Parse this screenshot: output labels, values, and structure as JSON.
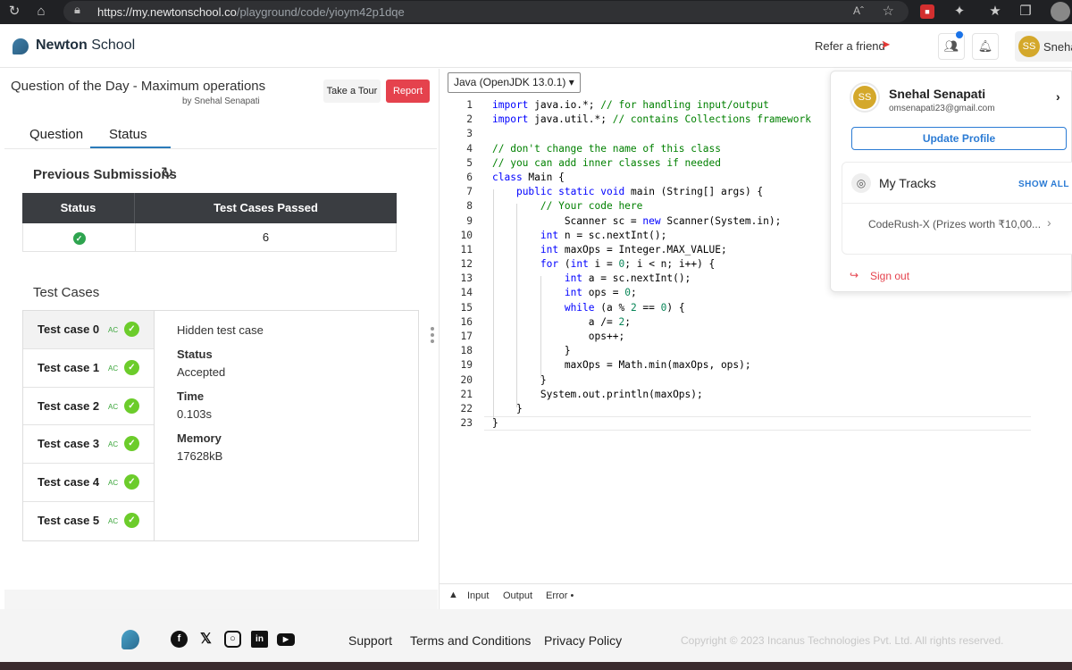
{
  "browser": {
    "url_host": "https://my.newtonschool.co",
    "url_path": "/playground/code/yioym42p1dqe",
    "read_aloud": "Á"
  },
  "topnav": {
    "logo_bold": "Newton",
    "logo_rest": " School",
    "refer": "Refer a friend",
    "user_initials": "SS",
    "user_name": "Sneha"
  },
  "question": {
    "title": "Question of the Day - Maximum operations",
    "by": "by Snehal Senapati",
    "tour_label": "Take a Tour",
    "report_label": "Report"
  },
  "tabs": [
    "Question",
    "Status"
  ],
  "submissions": {
    "title": "Previous Submissions",
    "columns": [
      "Status",
      "Test Cases Passed"
    ],
    "rows": [
      {
        "status": "passed",
        "passed": "6"
      }
    ]
  },
  "test_cases": {
    "title": "Test Cases",
    "items": [
      {
        "label": "Test case 0",
        "badge": "AC"
      },
      {
        "label": "Test case 1",
        "badge": "AC"
      },
      {
        "label": "Test case 2",
        "badge": "AC"
      },
      {
        "label": "Test case 3",
        "badge": "AC"
      },
      {
        "label": "Test case 4",
        "badge": "AC"
      },
      {
        "label": "Test case 5",
        "badge": "AC"
      }
    ],
    "detail": {
      "heading": "Hidden test case",
      "status_label": "Status",
      "status_value": "Accepted",
      "time_label": "Time",
      "time_value": "0.103s",
      "memory_label": "Memory",
      "memory_value": "17628kB"
    }
  },
  "editor": {
    "language": "Java (OpenJDK 13.0.1)",
    "lines": [
      "import java.io.*; // for handling input/output",
      "import java.util.*; // contains Collections framework",
      "",
      "// don't change the name of this class",
      "// you can add inner classes if needed",
      "class Main {",
      "    public static void main (String[] args) {",
      "        // Your code here",
      "            Scanner sc = new Scanner(System.in);",
      "        int n = sc.nextInt();",
      "        int maxOps = Integer.MAX_VALUE;",
      "        for (int i = 0; i < n; i++) {",
      "            int a = sc.nextInt();",
      "            int ops = 0;",
      "            while (a % 2 == 0) {",
      "                a /= 2;",
      "                ops++;",
      "            }",
      "            maxOps = Math.min(maxOps, ops);",
      "        }",
      "        System.out.println(maxOps);",
      "    }",
      "}"
    ],
    "bottom_tabs": [
      "Input",
      "Output",
      "Error"
    ]
  },
  "profile_menu": {
    "initials": "SS",
    "name": "Snehal Senapati",
    "email": "omsenapati23@gmail.com",
    "update_label": "Update Profile",
    "tracks_title": "My Tracks",
    "show_all": "SHOW ALL",
    "track_item": "CodeRush-X (Prizes worth ₹10,00...",
    "sign_out": "Sign out"
  },
  "footer": {
    "links": [
      "Support",
      "Terms and Conditions",
      "Privacy Policy"
    ],
    "copyright": "Copyright © 2023 Incanus Technologies Pvt. Ltd. All rights reserved."
  },
  "colors": {
    "accent": "#2b7bd4",
    "report": "#e5424d",
    "success": "#6ccc2b",
    "code_keyword": "#0000ff",
    "code_comment": "#008000"
  }
}
